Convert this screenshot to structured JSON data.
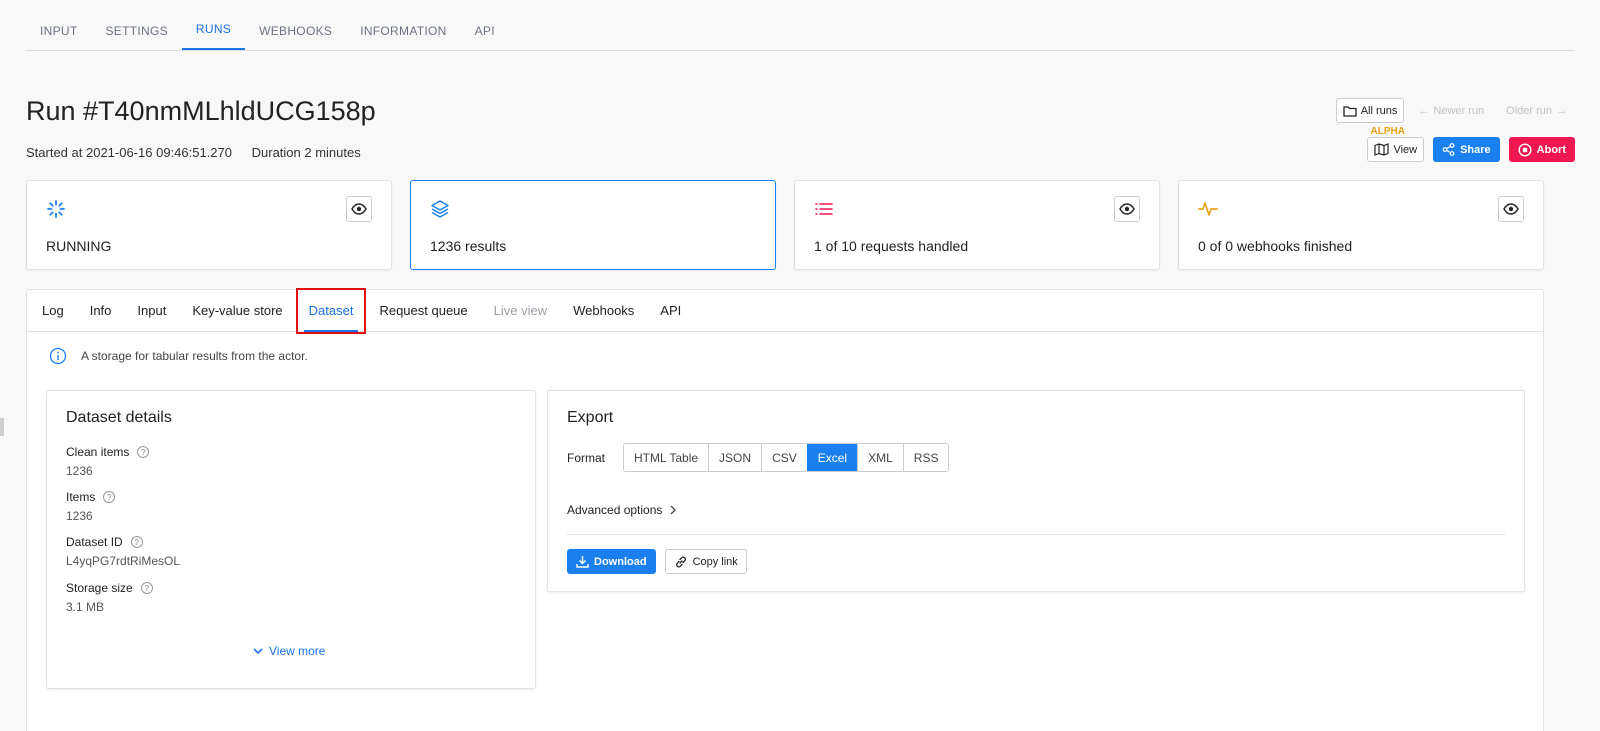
{
  "topnav": {
    "tabs": [
      "INPUT",
      "SETTINGS",
      "RUNS",
      "WEBHOOKS",
      "INFORMATION",
      "API"
    ],
    "active": "RUNS"
  },
  "run": {
    "title": "Run #T40nmMLhldUCG158p",
    "started": "Started at 2021-06-16 09:46:51.270",
    "duration": "Duration 2 minutes"
  },
  "header_buttons": {
    "all_runs": "All runs",
    "newer_run": "Newer run",
    "older_run": "Older run",
    "alpha": "ALPHA",
    "view": "View",
    "share": "Share",
    "abort": "Abort"
  },
  "cards": [
    {
      "icon": "spinner-icon",
      "value": "RUNNING"
    },
    {
      "icon": "layers-icon",
      "value": "1236 results"
    },
    {
      "icon": "list-icon",
      "value": "1 of 10 requests handled"
    },
    {
      "icon": "activity-icon",
      "value": "0 of 0 webhooks finished"
    }
  ],
  "subtabs": [
    "Log",
    "Info",
    "Input",
    "Key-value store",
    "Dataset",
    "Request queue",
    "Live view",
    "Webhooks",
    "API"
  ],
  "active_subtab": "Dataset",
  "info_text": "A storage for tabular results from the actor.",
  "details": {
    "title": "Dataset details",
    "fields": [
      {
        "label": "Clean items",
        "value": "1236"
      },
      {
        "label": "Items",
        "value": "1236"
      },
      {
        "label": "Dataset ID",
        "value": "L4yqPG7rdtRiMesOL"
      },
      {
        "label": "Storage size",
        "value": "3.1 MB"
      }
    ],
    "view_more": "View more"
  },
  "export": {
    "title": "Export",
    "format_label": "Format",
    "formats": [
      "HTML Table",
      "JSON",
      "CSV",
      "Excel",
      "XML",
      "RSS"
    ],
    "selected_format": "Excel",
    "advanced": "Advanced options",
    "download": "Download",
    "copy_link": "Copy link"
  },
  "colors": {
    "accent": "#1a80f0",
    "danger": "#f0164f",
    "alpha": "#e8a317",
    "highlight": "#e41010"
  }
}
